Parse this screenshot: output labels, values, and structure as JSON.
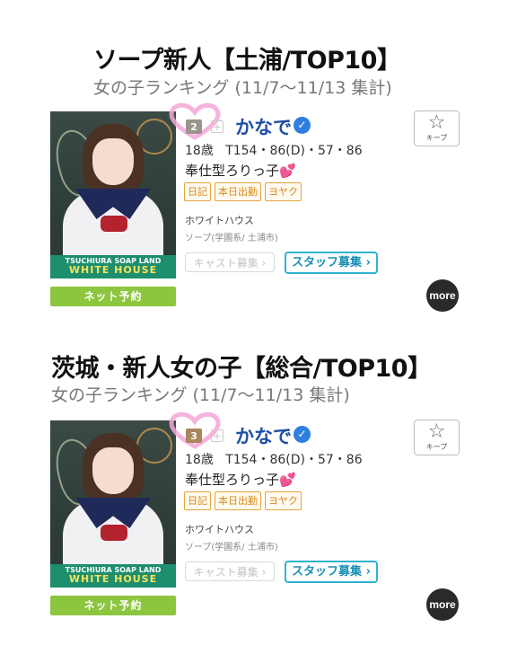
{
  "sections": [
    {
      "title": "ソープ新人【土浦/TOP10】",
      "subtitle": "女の子ランキング (11/7〜11/13 集計)",
      "rank": "2",
      "name": "かなで",
      "age": "18歳",
      "measurements": "T154・86(D)・57・86",
      "catchphrase": "奉仕型ろりっ子",
      "catch_emoji": "💕",
      "tags": [
        "日記",
        "本日出勤",
        "ヨヤク"
      ],
      "shop": "ホワイトハウス",
      "category": "ソープ(学園系/ 土浦市)",
      "cast_button": "キャスト募集 ›",
      "staff_button": "スタッフ募集 ›",
      "keep_label": "キープ",
      "more_label": "more",
      "net_button": "ネット予約",
      "photo_banner_top": "TSUCHIURA SOAP LAND",
      "photo_banner_main": "WHITE HOUSE"
    },
    {
      "title": "茨城・新人女の子【総合/TOP10】",
      "subtitle": "女の子ランキング (11/7〜11/13 集計)",
      "rank": "3",
      "name": "かなで",
      "age": "18歳",
      "measurements": "T154・86(D)・57・86",
      "catchphrase": "奉仕型ろりっ子",
      "catch_emoji": "💕",
      "tags": [
        "日記",
        "本日出勤",
        "ヨヤク"
      ],
      "shop": "ホワイトハウス",
      "category": "ソープ(学園系/ 土浦市)",
      "cast_button": "キャスト募集 ›",
      "staff_button": "スタッフ募集 ›",
      "keep_label": "キープ",
      "more_label": "more",
      "net_button": "ネット予約",
      "photo_banner_top": "TSUCHIURA SOAP LAND",
      "photo_banner_main": "WHITE HOUSE"
    }
  ],
  "icons": {
    "rank": "crown-rank-icon",
    "plus": "plus-icon",
    "verified": "verified-check-icon",
    "keep": "star-icon",
    "heart": "heart-icon"
  },
  "colors": {
    "name": "#1f4fa3",
    "verified": "#2f7fe0",
    "tag": "#d58a1c",
    "staff_button": "#2fb3cf",
    "net_button": "#8cc63f",
    "heart": "#f4a6d7"
  }
}
